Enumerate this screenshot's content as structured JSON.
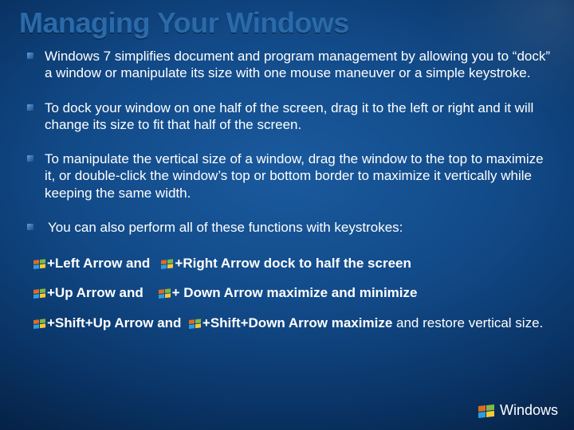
{
  "title": "Managing Your Windows",
  "bullets": [
    "Windows 7 simplifies document and program management by allowing you to “dock” a window or manipulate its size with one mouse maneuver or a simple keystroke.",
    "To dock your window on one half of the screen, drag it to the left or right and it will change its size to fit that half of the screen.",
    "To manipulate the vertical size of a window, drag the window to the top to maximize it, or double-click the window’s top or bottom border to maximize it vertically while keeping the same width.",
    "You can also perform all of these functions with keystrokes:"
  ],
  "keystrokes": {
    "row1": {
      "a": "+Left Arrow and",
      "b": "+Right Arrow dock to half the screen"
    },
    "row2": {
      "a": "+Up Arrow and",
      "b": "+ Down Arrow maximize and minimize"
    },
    "row3": {
      "a": "+Shift+Up Arrow and",
      "b": "+Shift+Down Arrow maximize",
      "tail": " and restore vertical size."
    }
  },
  "footer": {
    "product": "Windows"
  }
}
